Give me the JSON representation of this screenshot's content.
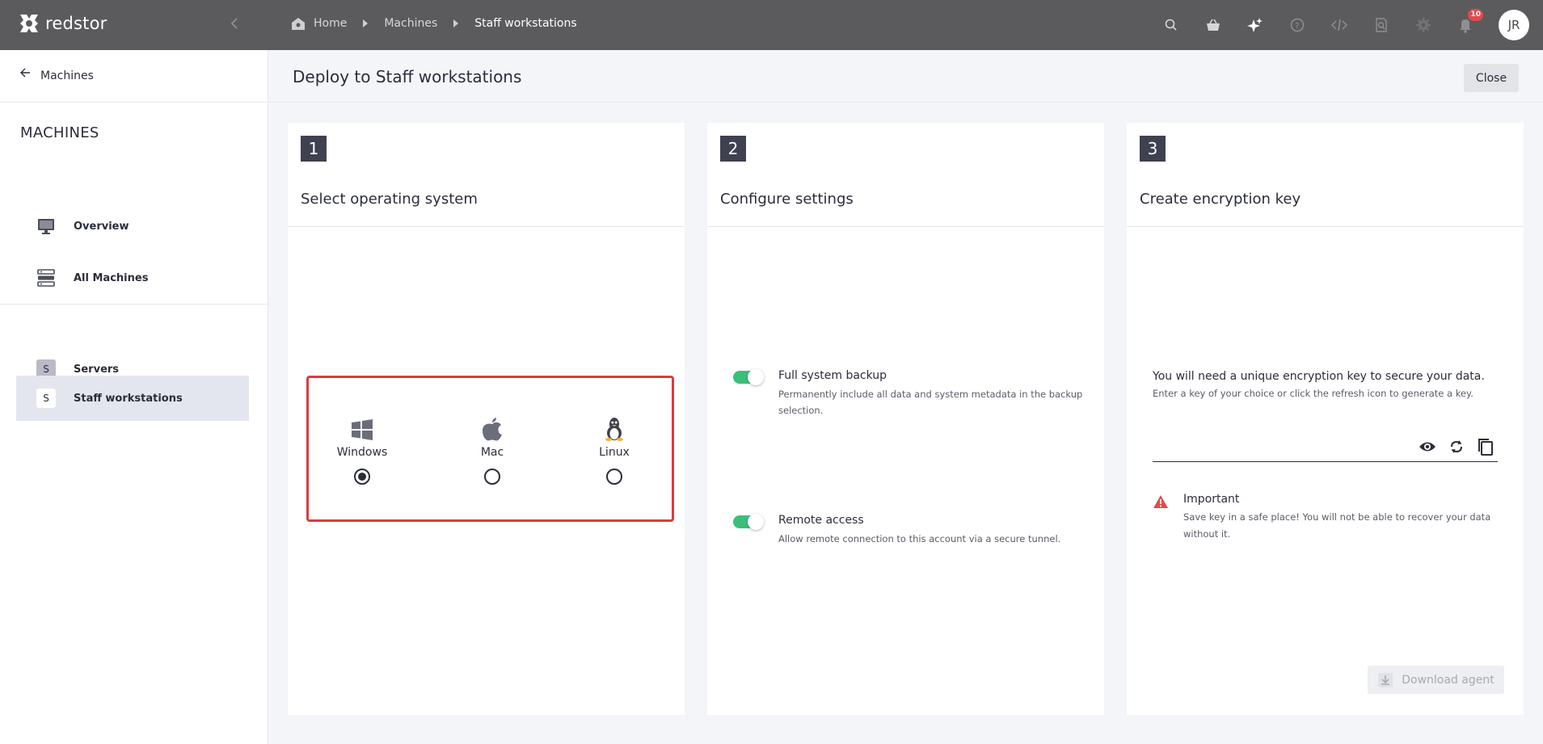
{
  "app": {
    "name": "redstor"
  },
  "breadcrumb": [
    "Home",
    "Machines",
    "Staff workstations"
  ],
  "notifications": {
    "count": "10"
  },
  "user": {
    "initials": "JR"
  },
  "sidebar": {
    "back_label": "Machines",
    "section_title": "MACHINES",
    "items": [
      {
        "label": "Overview",
        "icon": "monitor-icon"
      },
      {
        "label": "All Machines",
        "icon": "server-stack-icon"
      }
    ],
    "groups": [
      {
        "letter": "S",
        "label": "Servers",
        "active": false
      },
      {
        "letter": "S",
        "label": "Staff workstations",
        "active": true
      }
    ]
  },
  "page": {
    "title": "Deploy to Staff workstations",
    "close_label": "Close"
  },
  "steps": [
    {
      "number": "1",
      "title": "Select operating system"
    },
    {
      "number": "2",
      "title": "Configure settings"
    },
    {
      "number": "3",
      "title": "Create encryption key"
    }
  ],
  "os_options": [
    {
      "label": "Windows",
      "icon": "windows-icon",
      "selected": true
    },
    {
      "label": "Mac",
      "icon": "apple-icon",
      "selected": false
    },
    {
      "label": "Linux",
      "icon": "linux-icon",
      "selected": false
    }
  ],
  "settings": [
    {
      "title": "Full system backup",
      "description": "Permanently include all data and system metadata in the backup selection.",
      "enabled": true
    },
    {
      "title": "Remote access",
      "description": "Allow remote connection to this account via a secure tunnel.",
      "enabled": true
    }
  ],
  "encryption": {
    "intro": "You will need a unique encryption key to secure your data.",
    "hint": "Enter a key of your choice or click the refresh icon to generate a key.",
    "key_value": "",
    "important_title": "Important",
    "important_text": "Save key in a safe place! You will not be able to recover your data without it.",
    "download_label": "Download agent"
  },
  "colors": {
    "topbar": "#5b5b5e",
    "accent_toggle": "#3cbf7a",
    "highlight_border": "#e0393e",
    "step_badge": "#3f4150",
    "badge": "#e04b4b"
  }
}
